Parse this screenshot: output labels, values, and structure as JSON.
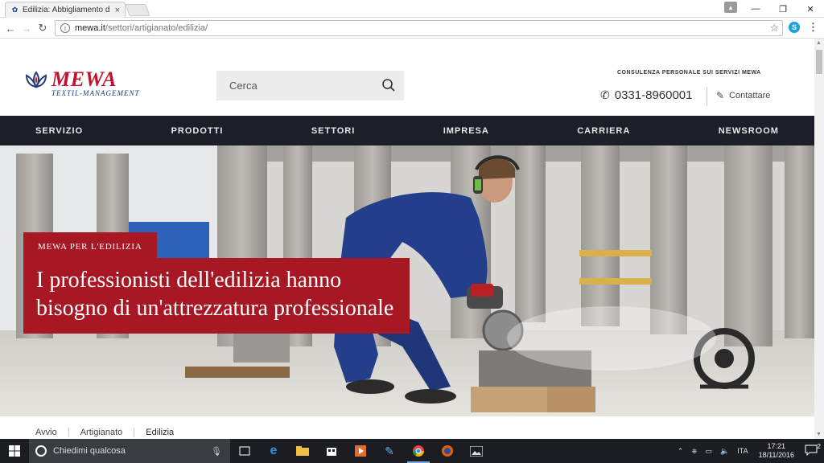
{
  "browser": {
    "tab_title": "Edilizia: Abbigliamento d",
    "url_host": "mewa.it",
    "url_path": "/settori/artigianato/edilizia/"
  },
  "header": {
    "logo_name": "MEWA",
    "logo_tagline": "TEXTIL-MANAGEMENT",
    "search_placeholder": "Cerca",
    "consult_label": "CONSULENZA PERSONALE SUI SERVIZI MEWA",
    "phone": "0331-8960001",
    "contact_label": "Contattare"
  },
  "nav": {
    "items": [
      "SERVIZIO",
      "PRODOTTI",
      "SETTORI",
      "IMPRESA",
      "CARRIERA",
      "NEWSROOM"
    ]
  },
  "hero": {
    "kicker": "MEWA PER L'EDILIZIA",
    "headline": "I professionisti dell'edilizia hanno bisogno di un'attrezzatura professionale"
  },
  "breadcrumb": {
    "items": [
      "Avvio",
      "Artigianato",
      "Edilizia"
    ]
  },
  "taskbar": {
    "search_placeholder": "Chiedimi qualcosa",
    "language": "ITA",
    "time": "17:21",
    "date": "18/11/2016",
    "notifications": "2"
  },
  "colors": {
    "brand_red": "#c3102d",
    "hero_red": "#a71824",
    "nav_dark": "#1c1f28",
    "brand_blue": "#1f3a7a"
  }
}
